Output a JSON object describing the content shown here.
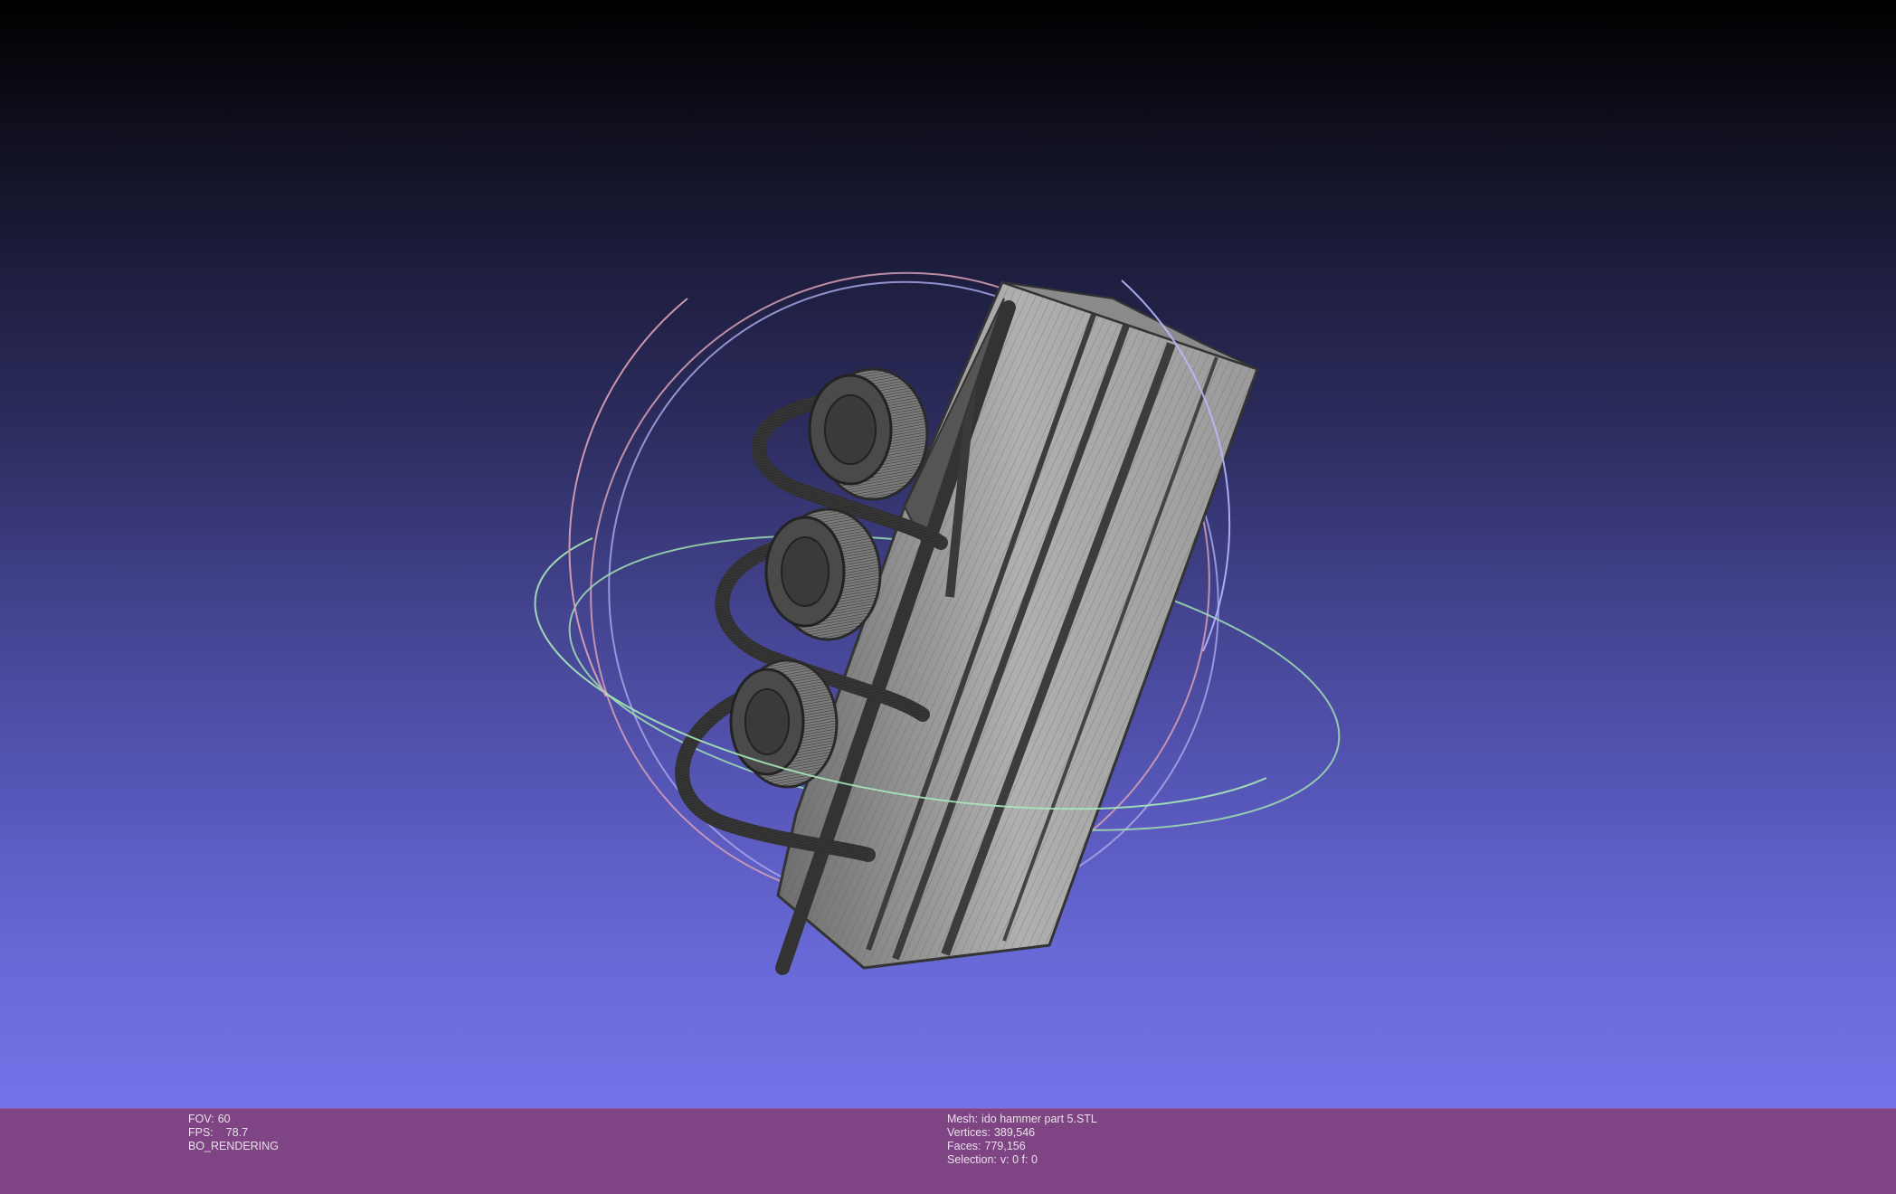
{
  "viewer": {
    "fov_label": "FOV:",
    "fov_value": "60",
    "fps_label": "FPS:",
    "fps_value": "78.7",
    "render_mode": "BO_RENDERING"
  },
  "mesh_info": {
    "mesh_label": "Mesh:",
    "mesh_name": "ido hammer part 5.STL",
    "vertices_label": "Vertices:",
    "vertices_value": "389,546",
    "faces_label": "Faces:",
    "faces_value": "779,156",
    "selection_label": "Selection:",
    "selection_value": "v: 0 f: 0"
  },
  "colors": {
    "status_bar": "#7e4483",
    "mesh_fill": "#a8a8a8",
    "mesh_dark": "#3a3a3a",
    "trackball_red": "#e0a0b0",
    "trackball_green": "#a8e8b0",
    "trackball_blue": "#b8b8ff"
  }
}
